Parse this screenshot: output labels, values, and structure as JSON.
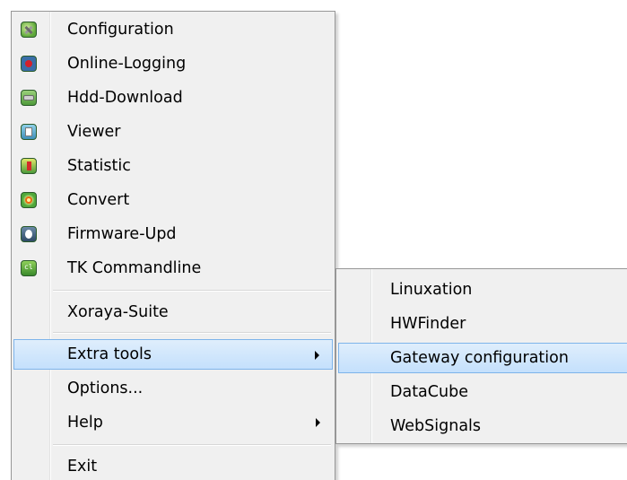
{
  "menu": {
    "items": [
      {
        "label": "Configuration",
        "icon": "configuration-icon"
      },
      {
        "label": "Online-Logging",
        "icon": "online-logging-icon"
      },
      {
        "label": "Hdd-Download",
        "icon": "hdd-download-icon"
      },
      {
        "label": "Viewer",
        "icon": "viewer-icon"
      },
      {
        "label": "Statistic",
        "icon": "statistic-icon"
      },
      {
        "label": "Convert",
        "icon": "convert-icon"
      },
      {
        "label": "Firmware-Upd",
        "icon": "firmware-update-icon"
      },
      {
        "label": "TK Commandline",
        "icon": "tk-commandline-icon"
      }
    ],
    "suite_label": "Xoraya-Suite",
    "extra_tools_label": "Extra tools",
    "options_label": "Options...",
    "help_label": "Help",
    "exit_label": "Exit"
  },
  "submenu": {
    "items": [
      {
        "label": "Linuxation"
      },
      {
        "label": "HWFinder"
      },
      {
        "label": "Gateway configuration"
      },
      {
        "label": "DataCube"
      },
      {
        "label": "WebSignals"
      }
    ],
    "highlighted": "Gateway configuration"
  },
  "colors": {
    "menu_bg": "#f0f0f0",
    "highlight_bg": "#c4e0fc",
    "highlight_border": "#7eb4ea"
  }
}
